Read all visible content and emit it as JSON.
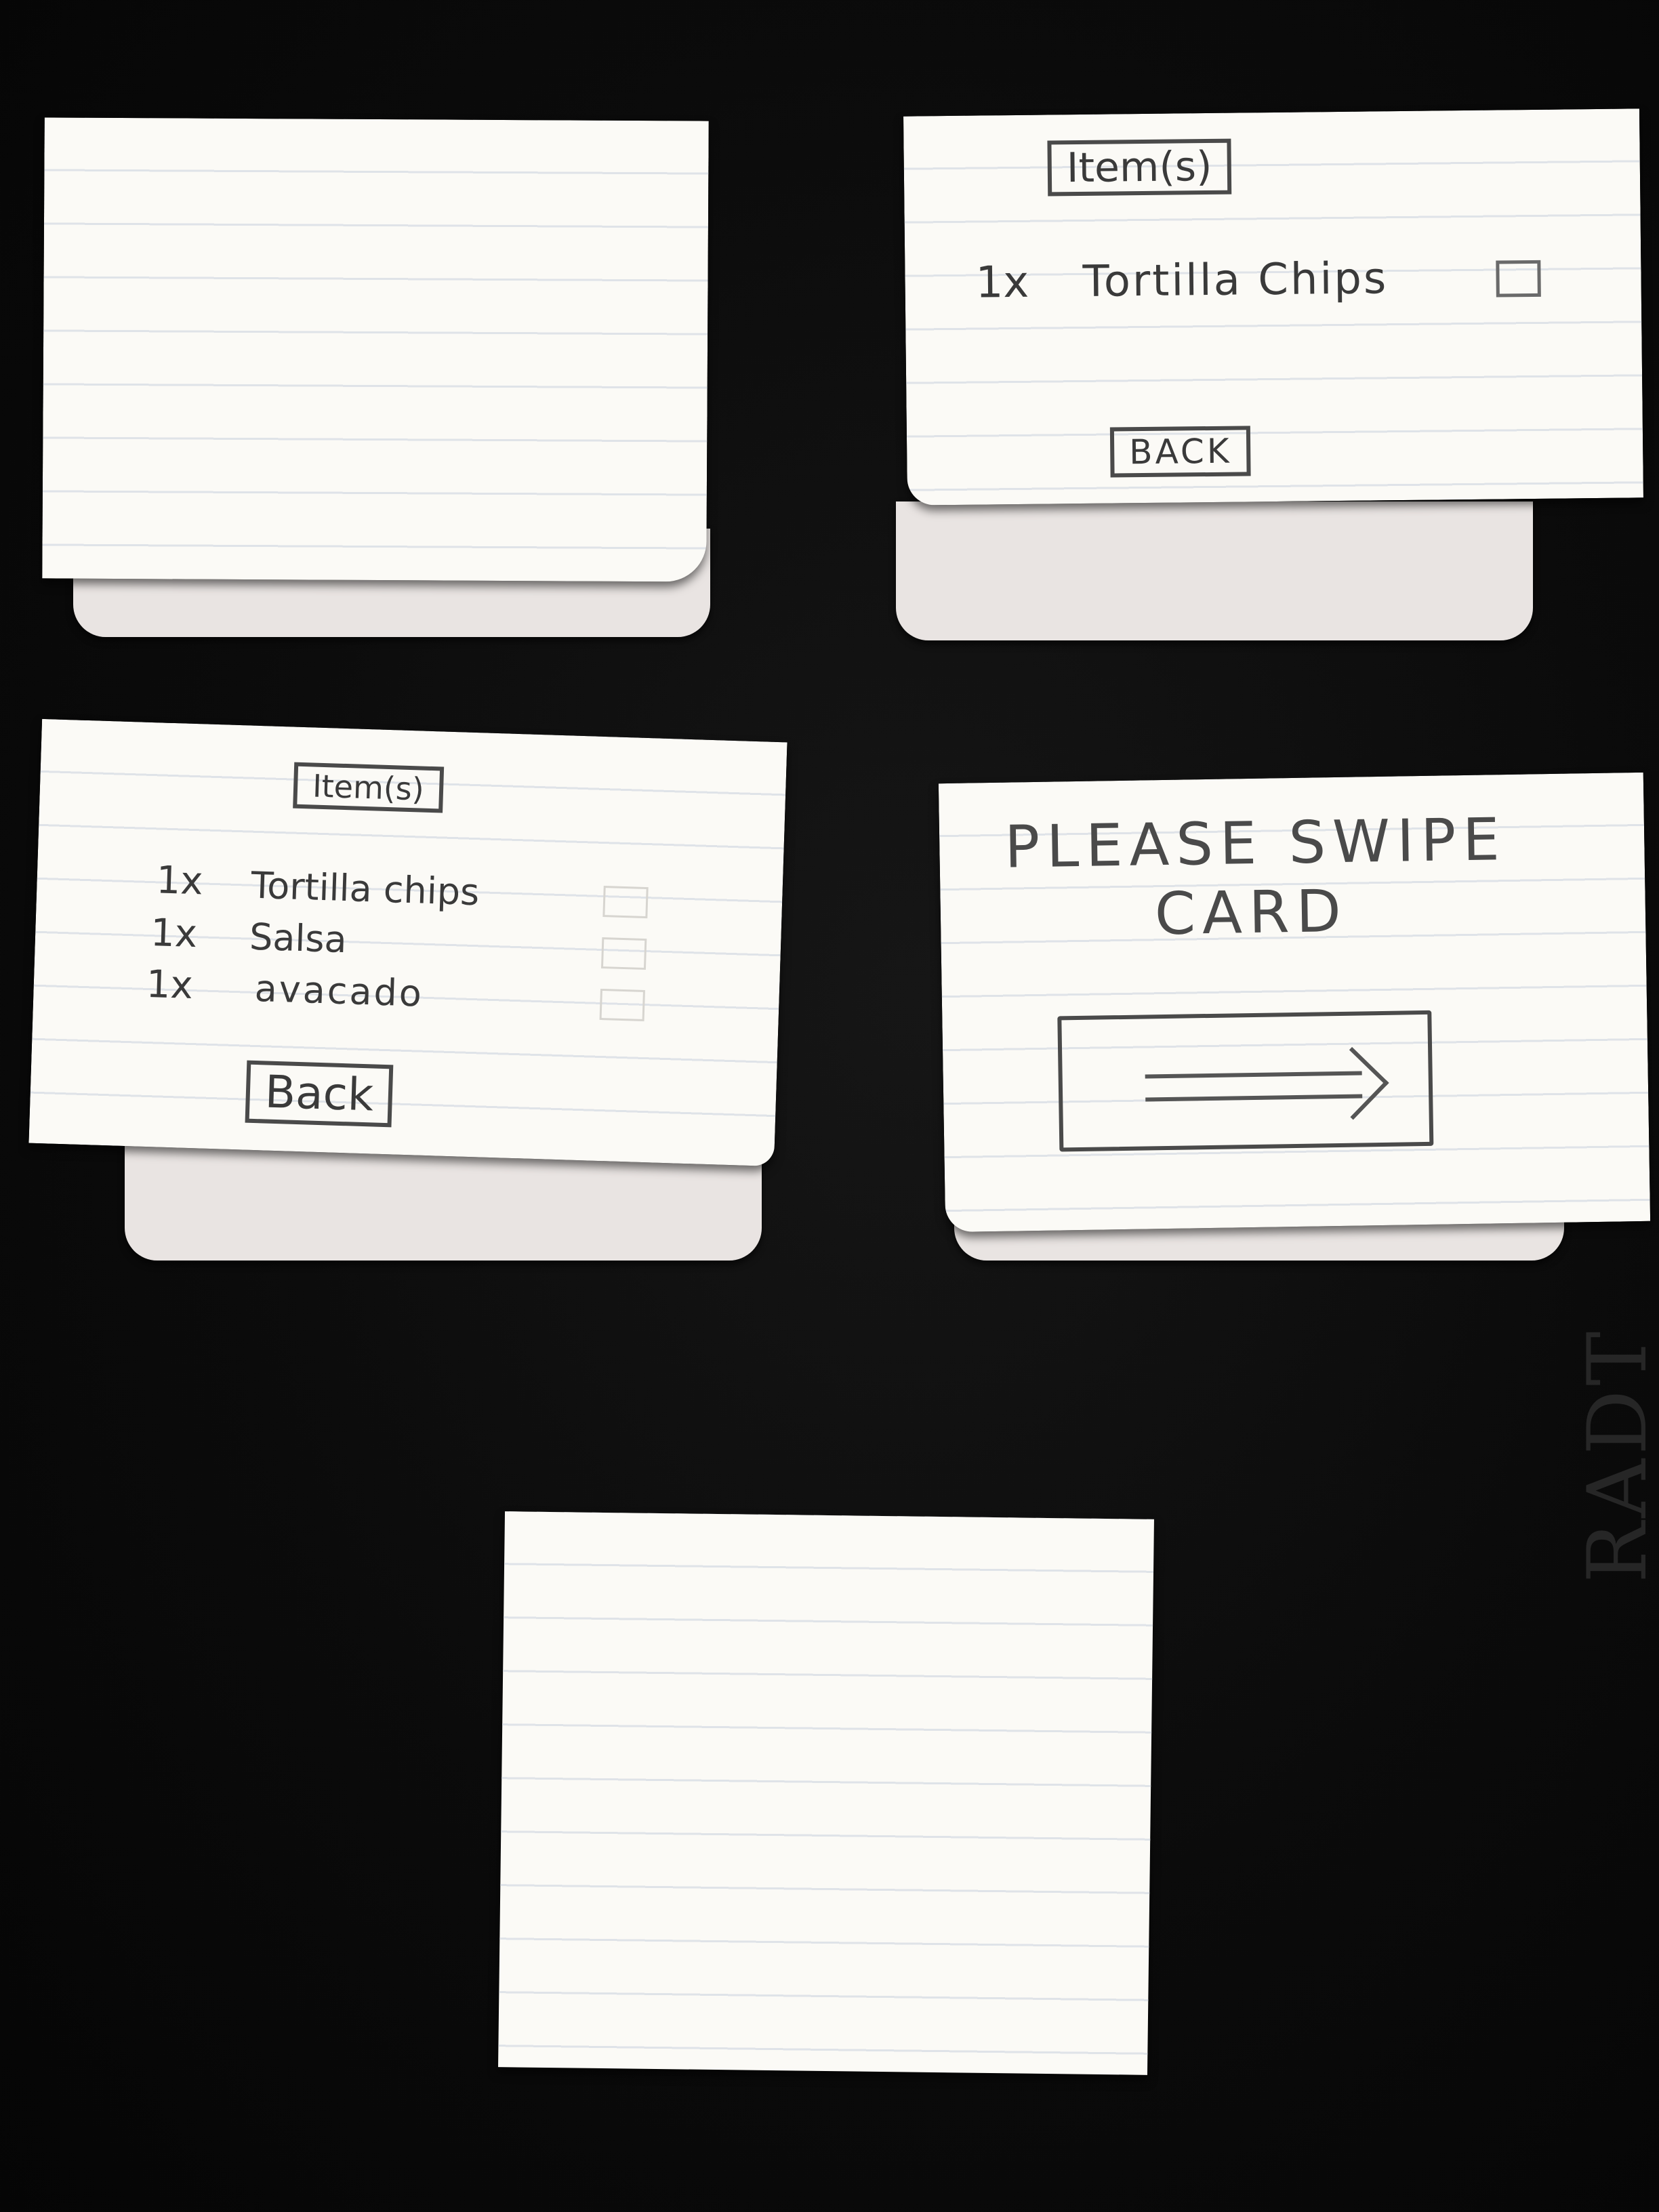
{
  "cards": [
    {
      "id": "blank-top-left",
      "lines": []
    },
    {
      "id": "single-item",
      "header": "Item(s)",
      "items": [
        {
          "qty": "1x",
          "name": "Tortilla Chips"
        }
      ],
      "back_label": "BACK"
    },
    {
      "id": "multi-item",
      "header": "Item(s)",
      "items": [
        {
          "qty": "1x",
          "name": "Tortilla chips"
        },
        {
          "qty": "1x",
          "name": "Salsa"
        },
        {
          "qty": "1x",
          "name": "avacado"
        }
      ],
      "back_label": "Back"
    },
    {
      "id": "swipe-card",
      "line1": "PLEASE SWIPE",
      "line2": "CARD"
    },
    {
      "id": "blank-bottom"
    }
  ],
  "background_mark": "RADT",
  "colors": {
    "background": "#0b0b0b",
    "card": "#fbfaf6",
    "ink": "#3a3a3a",
    "rule_lines": "#dfe3e8"
  }
}
